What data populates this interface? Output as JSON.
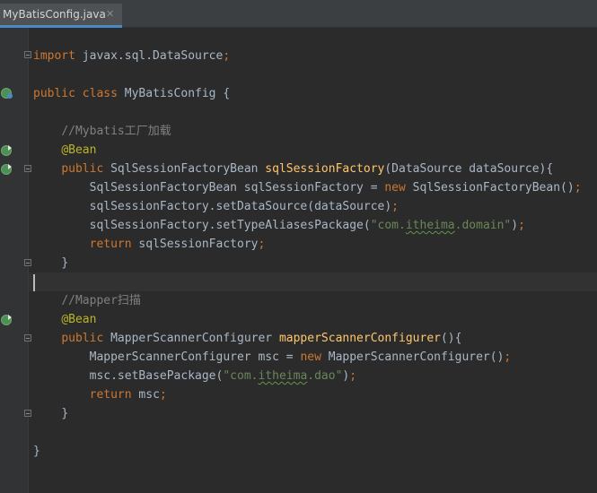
{
  "editor_tab": {
    "filename": "MyBatisConfig.java",
    "close_glyph": "✕"
  },
  "icons": [
    "bean-config-icon",
    "bean-navigate-icon",
    "fold-icon",
    "close-icon"
  ],
  "colors": {
    "background": "#2b2b2b",
    "keyword": "#cc7832",
    "string": "#6a8759",
    "comment": "#808080",
    "annotation": "#bbb529",
    "method": "#ffc66d",
    "text": "#a9b7c6"
  },
  "code": {
    "l1": {
      "kw": "import",
      "rest": " javax.sql.DataSource",
      "semi": ";"
    },
    "l3": {
      "kw1": "public",
      "kw2": "class",
      "name": " MyBatisConfig {"
    },
    "l5": {
      "comment": "//Mybatis工厂加载"
    },
    "l6": {
      "ann": "@Bean"
    },
    "l7": {
      "kw": "public",
      "type": " SqlSessionFactoryBean ",
      "method": "sqlSessionFactory",
      "params": "(DataSource dataSource){"
    },
    "l8": {
      "pre": "SqlSessionFactoryBean sqlSessionFactory = ",
      "kw": "new",
      "post": " SqlSessionFactoryBean()",
      "semi": ";"
    },
    "l9": {
      "pre": "sqlSessionFactory.setDataSource(dataSource)",
      "semi": ";"
    },
    "l10": {
      "pre": "sqlSessionFactory.setTypeAliasesPackage(",
      "str_a": "\"com.",
      "str_b": "itheima",
      "str_c": ".domain\"",
      "post": ")",
      "semi": ";"
    },
    "l11": {
      "kw": "return",
      "rest": " sqlSessionFactory",
      "semi": ";"
    },
    "l12": {
      "brace": "}"
    },
    "l14": {
      "comment": "//Mapper扫描"
    },
    "l15": {
      "ann": "@Bean"
    },
    "l16": {
      "kw": "public",
      "type": " MapperScannerConfigurer ",
      "method": "mapperScannerConfigurer",
      "params": "(){"
    },
    "l17": {
      "pre": "MapperScannerConfigurer msc = ",
      "kw": "new",
      "post": " MapperScannerConfigurer()",
      "semi": ";"
    },
    "l18": {
      "pre": "msc.setBasePackage(",
      "str_a": "\"com.",
      "str_b": "itheima",
      "str_c": ".dao\"",
      "post": ")",
      "semi": ";"
    },
    "l19": {
      "kw": "return",
      "rest": " msc",
      "semi": ";"
    },
    "l20": {
      "brace": "}"
    },
    "l22": {
      "brace": "}"
    }
  }
}
